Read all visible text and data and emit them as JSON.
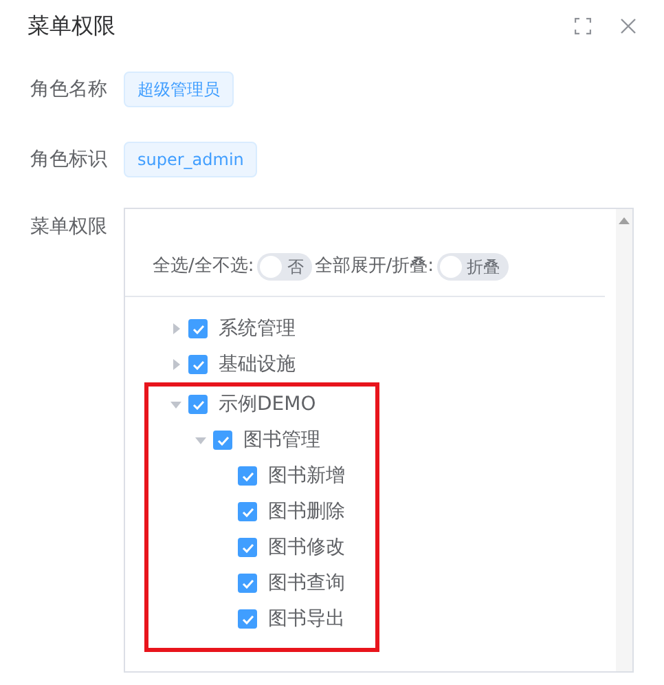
{
  "dialog": {
    "title": "菜单权限"
  },
  "fields": [
    {
      "label": "角色名称",
      "value": "超级管理员"
    },
    {
      "label": "角色标识",
      "value": "super_admin"
    }
  ],
  "menu_permissions": {
    "label": "菜单权限",
    "switches": [
      {
        "label": "全选/全不选:",
        "text": "否",
        "on": false
      },
      {
        "label": "全部展开/折叠:",
        "text": "折叠",
        "on": false
      }
    ],
    "tree": [
      {
        "label": "系统管理",
        "checked": true,
        "expanded": false,
        "highlighted": false
      },
      {
        "label": "基础设施",
        "checked": true,
        "expanded": false,
        "highlighted": false
      },
      {
        "label": "示例DEMO",
        "checked": true,
        "expanded": true,
        "highlighted": true,
        "children": [
          {
            "label": "图书管理",
            "checked": true,
            "expanded": true,
            "children": [
              {
                "label": "图书新增",
                "checked": true
              },
              {
                "label": "图书删除",
                "checked": true
              },
              {
                "label": "图书修改",
                "checked": true
              },
              {
                "label": "图书查询",
                "checked": true
              },
              {
                "label": "图书导出",
                "checked": true
              }
            ]
          }
        ]
      }
    ]
  }
}
